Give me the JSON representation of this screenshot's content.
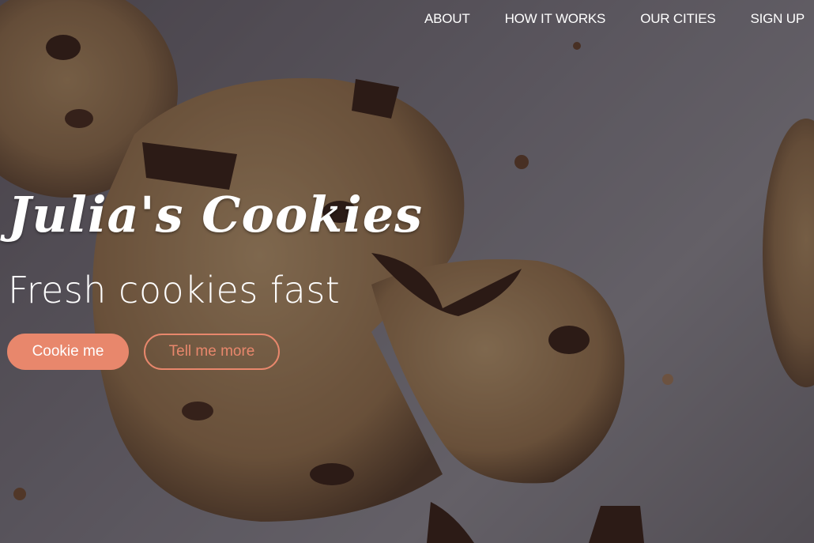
{
  "nav": {
    "items": [
      {
        "label": "ABOUT"
      },
      {
        "label": "HOW IT WORKS"
      },
      {
        "label": "OUR CITIES"
      },
      {
        "label": "SIGN UP"
      }
    ]
  },
  "hero": {
    "title": "Julia's Cookies",
    "subtitle": "Fresh cookies fast",
    "primary_button": "Cookie me",
    "secondary_button": "Tell me more"
  },
  "colors": {
    "accent": "#e8876c",
    "text": "#ffffff"
  }
}
